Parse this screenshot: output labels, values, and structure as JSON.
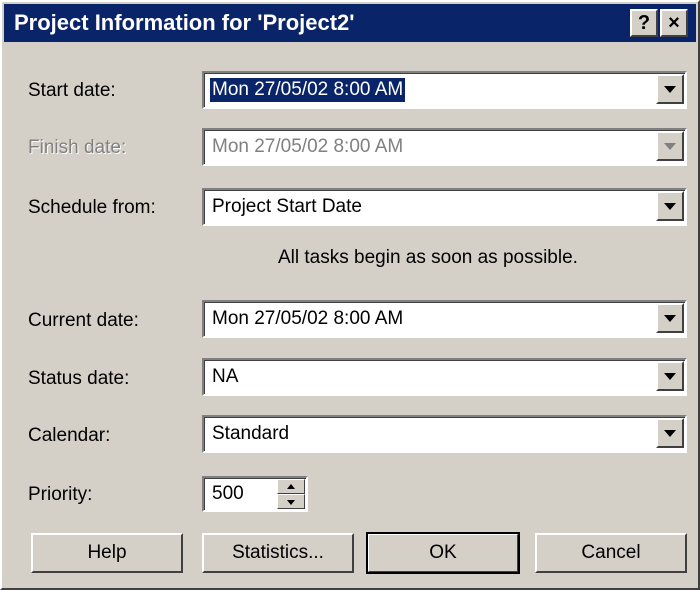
{
  "window": {
    "title": "Project Information for 'Project2'",
    "help_glyph": "?",
    "close_glyph": "×"
  },
  "fields": {
    "start_date": {
      "label": "Start date:",
      "value": "Mon 27/05/02 8:00 AM"
    },
    "finish_date": {
      "label": "Finish date:",
      "value": "Mon 27/05/02 8:00 AM",
      "disabled": true
    },
    "schedule_from": {
      "label": "Schedule from:",
      "value": "Project Start Date"
    },
    "hint": "All tasks begin as soon as possible.",
    "current_date": {
      "label": "Current date:",
      "value": "Mon 27/05/02 8:00 AM"
    },
    "status_date": {
      "label": "Status date:",
      "value": "NA"
    },
    "calendar": {
      "label": "Calendar:",
      "value": "Standard"
    },
    "priority": {
      "label": "Priority:",
      "value": "500"
    }
  },
  "buttons": {
    "help": "Help",
    "statistics": "Statistics...",
    "ok": "OK",
    "cancel": "Cancel"
  },
  "colors": {
    "title_bar": "#0a246a",
    "face": "#d4d0c8",
    "selection": "#0a246a",
    "disabled_text": "#808080"
  },
  "icons": [
    "help-icon",
    "close-icon",
    "dropdown-arrow-icon",
    "spin-up-icon",
    "spin-down-icon"
  ]
}
